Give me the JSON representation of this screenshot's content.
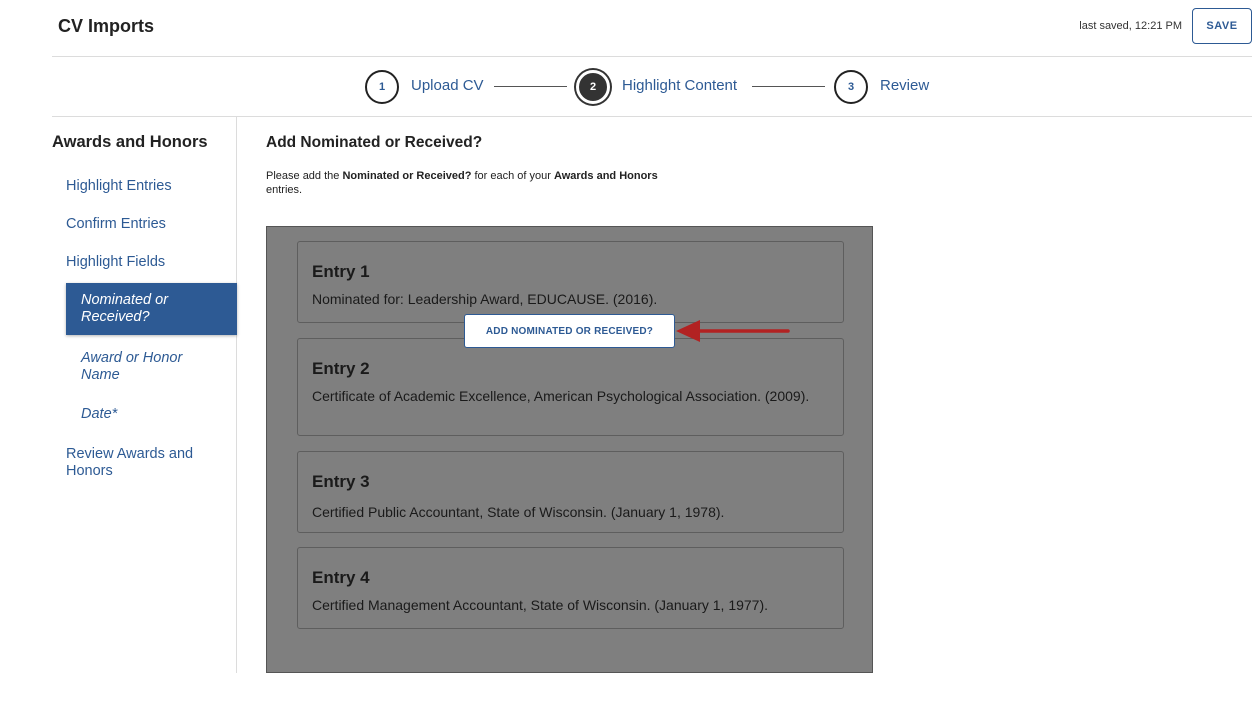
{
  "header": {
    "title": "CV Imports",
    "last_saved": "last saved, 12:21 PM",
    "save_label": "SAVE"
  },
  "stepper": {
    "steps": [
      {
        "number": "1",
        "label": "Upload CV",
        "active": false
      },
      {
        "number": "2",
        "label": "Highlight Content",
        "active": true
      },
      {
        "number": "3",
        "label": "Review",
        "active": false
      }
    ]
  },
  "sidebar": {
    "title": "Awards and Honors",
    "items": [
      {
        "label": "Highlight Entries"
      },
      {
        "label": "Confirm Entries"
      },
      {
        "label": "Highlight Fields"
      },
      {
        "label": "Nominated or Received?",
        "active": true
      },
      {
        "label": "Award or Honor Name"
      },
      {
        "label": "Date*"
      },
      {
        "label": "Review Awards and Honors"
      }
    ]
  },
  "main": {
    "title": "Add Nominated or Received?",
    "instructions": {
      "prefix": "Please add the ",
      "field": "Nominated or Received?",
      "middle": " for each of your ",
      "section": "Awards and Honors",
      "suffix": " entries."
    },
    "add_button_label": "ADD NOMINATED OR RECEIVED?",
    "entries": [
      {
        "title": "Entry 1",
        "text": "Nominated for: Leadership Award, EDUCAUSE. (2016)."
      },
      {
        "title": "Entry 2",
        "text": "Certificate of Academic Excellence, American Psychological Association. (2009)."
      },
      {
        "title": "Entry 3",
        "text": "Certified Public Accountant, State of Wisconsin. (January 1, 1978)."
      },
      {
        "title": "Entry 4",
        "text": "Certified Management Accountant, State of Wisconsin. (January 1, 1977)."
      }
    ]
  },
  "colors": {
    "accent": "#2d5a94",
    "overlay": "#7f7f7f",
    "annotation_arrow": "#b22222"
  },
  "icons": {
    "annotation": "red-arrow-icon"
  }
}
